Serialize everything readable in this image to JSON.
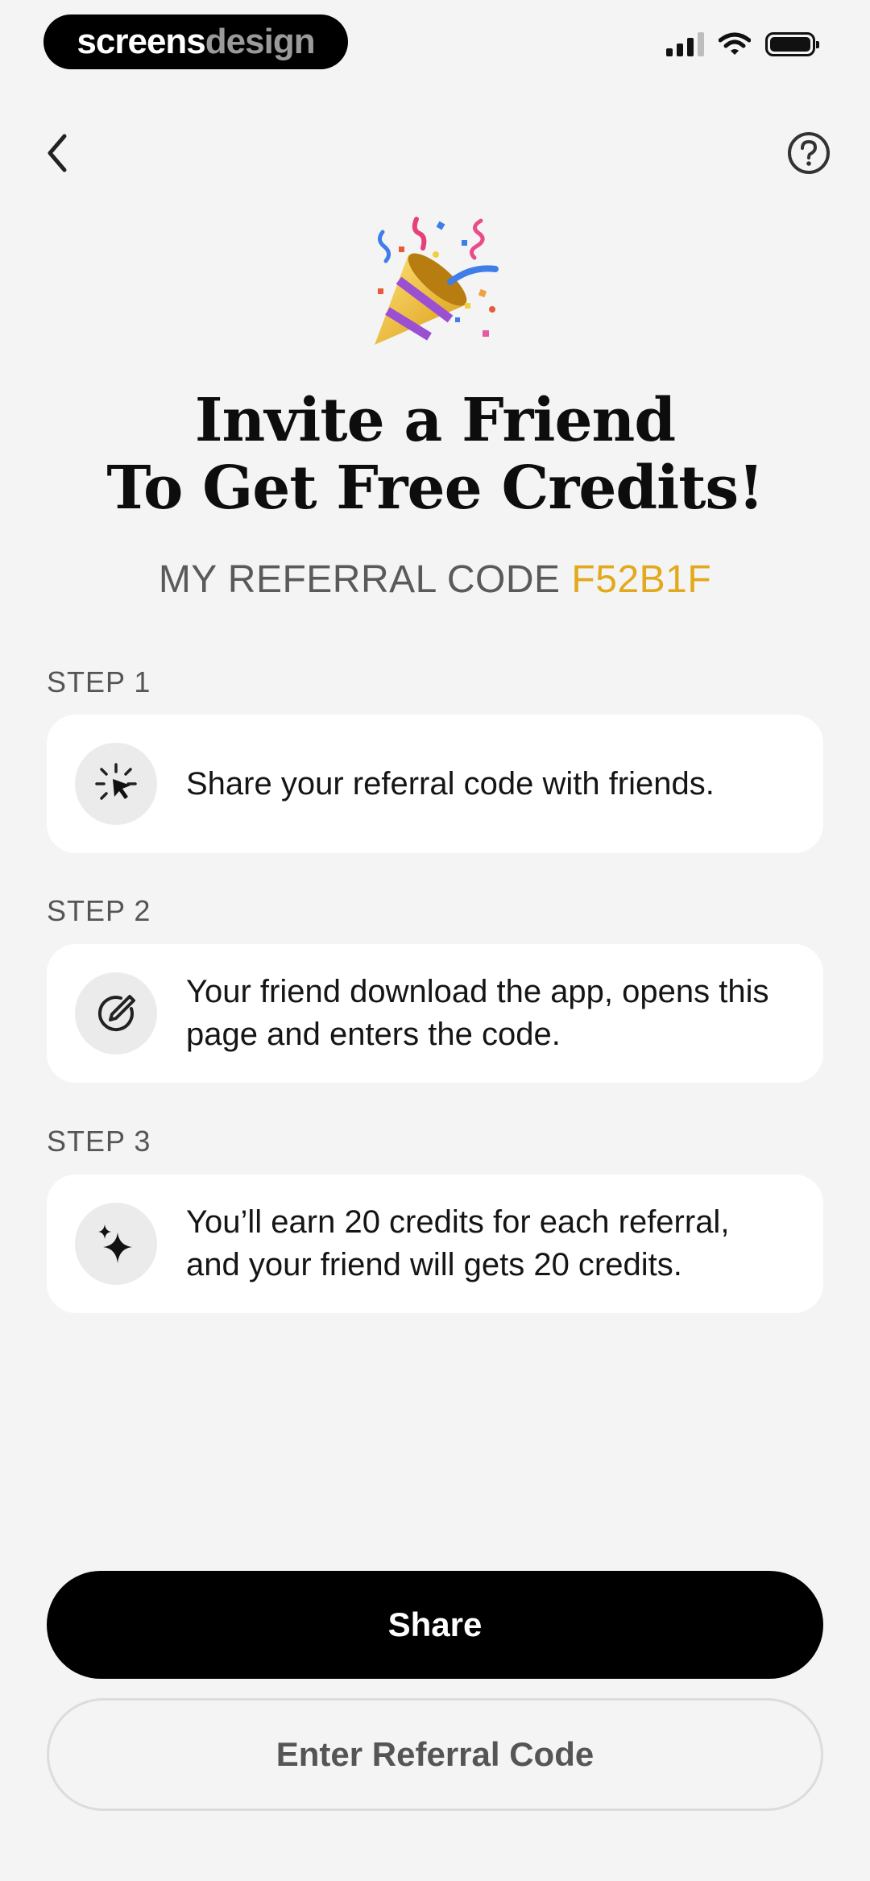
{
  "status_bar": {
    "brand_part1": "screens",
    "brand_part2": "design",
    "icons": [
      "cellular-signal-icon",
      "wifi-icon",
      "battery-icon"
    ]
  },
  "nav": {
    "back_icon": "chevron-left-icon",
    "help_icon": "question-circle-icon"
  },
  "hero": {
    "icon": "party-popper-icon",
    "title_line1": "Invite a Friend",
    "title_line2": "To Get Free Credits!",
    "referral_prefix": "MY REFERRAL CODE",
    "referral_code": "F52B1F",
    "referral_code_color": "#e2a91c"
  },
  "steps": [
    {
      "label": "STEP 1",
      "icon": "cursor-click-icon",
      "text": "Share your referral code with friends."
    },
    {
      "label": "STEP 2",
      "icon": "pen-circle-icon",
      "text": "Your friend download the app, opens this page and enters the code."
    },
    {
      "label": "STEP 3",
      "icon": "sparkles-icon",
      "text": "You’ll earn 20 credits for each referral, and your friend will gets 20 credits."
    }
  ],
  "actions": {
    "share_label": "Share",
    "enter_code_label": "Enter Referral Code"
  }
}
